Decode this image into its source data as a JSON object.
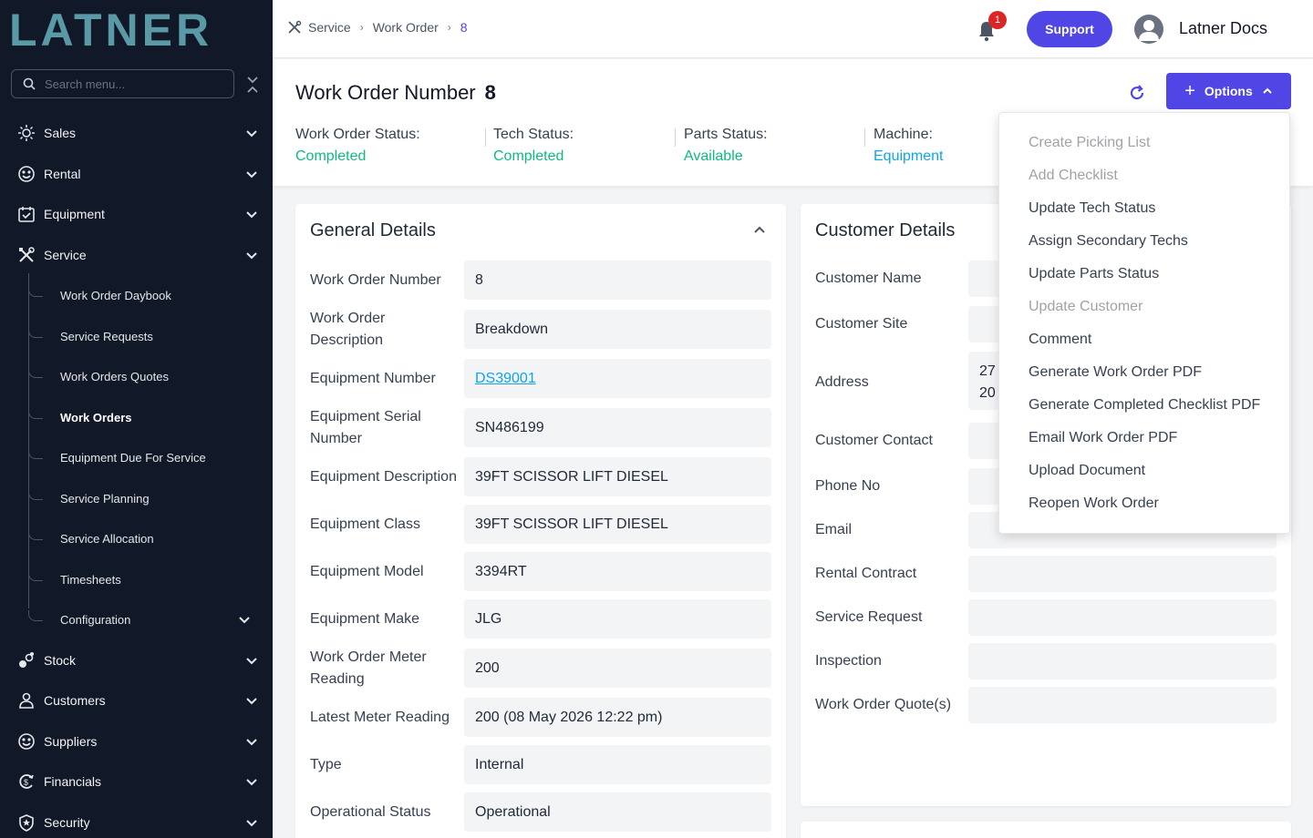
{
  "app": {
    "logo_text": "LATNER",
    "user_name": "Latner Docs",
    "support_label": "Support",
    "notification_count": "1"
  },
  "sidebar": {
    "search_placeholder": "Search menu...",
    "items": [
      {
        "label": "Sales",
        "icon": "sales-icon"
      },
      {
        "label": "Rental",
        "icon": "rental-icon"
      },
      {
        "label": "Equipment",
        "icon": "equipment-icon"
      },
      {
        "label": "Service",
        "icon": "service-icon"
      },
      {
        "label": "Stock",
        "icon": "stock-icon"
      },
      {
        "label": "Customers",
        "icon": "customers-icon"
      },
      {
        "label": "Suppliers",
        "icon": "suppliers-icon"
      },
      {
        "label": "Financials",
        "icon": "financials-icon"
      },
      {
        "label": "Security",
        "icon": "security-icon"
      }
    ],
    "service_sub": [
      {
        "label": "Work Order Daybook"
      },
      {
        "label": "Service Requests"
      },
      {
        "label": "Work Orders Quotes"
      },
      {
        "label": "Work Orders",
        "active": true
      },
      {
        "label": "Equipment Due For Service"
      },
      {
        "label": "Service Planning"
      },
      {
        "label": "Service Allocation"
      },
      {
        "label": "Timesheets"
      },
      {
        "label": "Configuration"
      }
    ]
  },
  "breadcrumb": {
    "items": [
      "Service",
      "Work Order",
      "8"
    ]
  },
  "header": {
    "title": "Work Order Number",
    "number": "8",
    "options_label": "Options",
    "statuses": [
      {
        "label": "Work Order Status:",
        "value": "Completed"
      },
      {
        "label": "Tech Status:",
        "value": "Completed"
      },
      {
        "label": "Parts Status:",
        "value": "Available"
      },
      {
        "label": "Machine:",
        "value": "Equipment"
      }
    ]
  },
  "general_details": {
    "title": "General Details",
    "rows": [
      {
        "label": "Work Order Number",
        "value": "8"
      },
      {
        "label": "Work Order Description",
        "value": "Breakdown"
      },
      {
        "label": "Equipment Number",
        "value": "DS39001"
      },
      {
        "label": "Equipment Serial Number",
        "value": "SN486199"
      },
      {
        "label": "Equipment Description",
        "value": "39FT SCISSOR LIFT DIESEL"
      },
      {
        "label": "Equipment Class",
        "value": "39FT SCISSOR LIFT DIESEL"
      },
      {
        "label": "Equipment Model",
        "value": "3394RT"
      },
      {
        "label": "Equipment Make",
        "value": "JLG"
      },
      {
        "label": "Work Order Meter Reading",
        "value": "200"
      },
      {
        "label": "Latest Meter Reading",
        "value": "200 (08 May 2026 12:22 pm)"
      },
      {
        "label": "Type",
        "value": "Internal"
      },
      {
        "label": "Operational Status",
        "value": "Operational"
      }
    ]
  },
  "customer_details": {
    "title": "Customer Details",
    "address_partial": [
      "27",
      "20"
    ],
    "rows": [
      {
        "label": "Customer Name"
      },
      {
        "label": "Customer Site"
      },
      {
        "label": "Address"
      },
      {
        "label": "Customer Contact"
      },
      {
        "label": "Phone No"
      },
      {
        "label": "Email"
      },
      {
        "label": "Rental Contract"
      },
      {
        "label": "Service Request"
      },
      {
        "label": "Inspection"
      },
      {
        "label": "Work Order Quote(s)"
      }
    ]
  },
  "options_menu": {
    "items": [
      {
        "label": "Create Picking List",
        "disabled": true
      },
      {
        "label": "Add Checklist",
        "disabled": true
      },
      {
        "label": "Update Tech Status",
        "disabled": false
      },
      {
        "label": "Assign Secondary Techs",
        "disabled": false
      },
      {
        "label": "Update Parts Status",
        "disabled": false
      },
      {
        "label": "Update Customer",
        "disabled": true
      },
      {
        "label": "Comment",
        "disabled": false
      },
      {
        "label": "Generate Work Order PDF",
        "disabled": false
      },
      {
        "label": "Generate Completed Checklist PDF",
        "disabled": false
      },
      {
        "label": "Email Work Order PDF",
        "disabled": false
      },
      {
        "label": "Upload Document",
        "disabled": false
      },
      {
        "label": "Reopen Work Order",
        "disabled": false
      }
    ]
  },
  "colors": {
    "sidebar_bg": "#111827",
    "accent": "#4f46e5",
    "status_green": "#10b981",
    "link_blue": "#0ea5e9",
    "logo_teal": "#5a9aa6"
  }
}
